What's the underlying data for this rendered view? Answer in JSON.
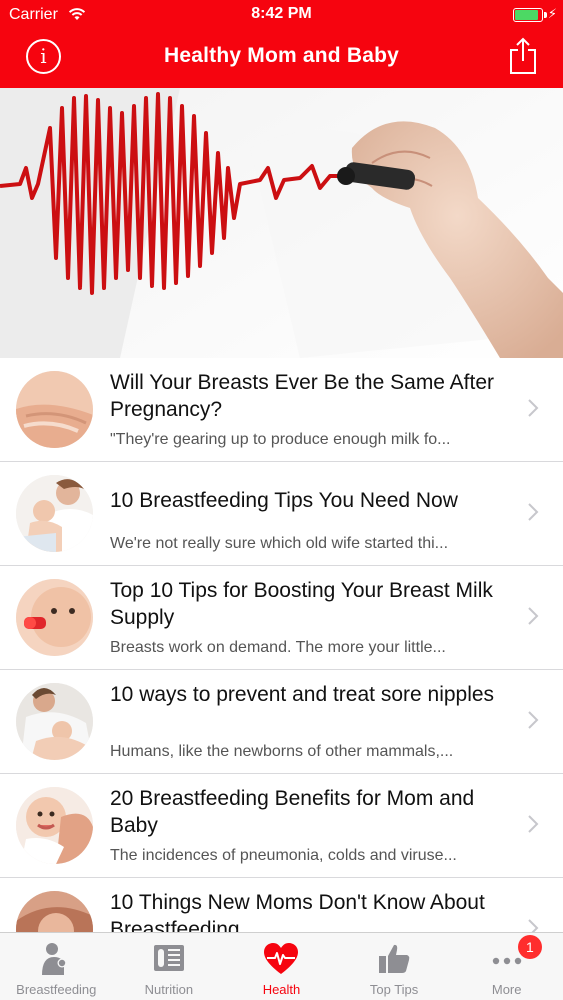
{
  "status_bar": {
    "carrier": "Carrier",
    "time": "8:42 PM",
    "battery_level": 0.9
  },
  "nav": {
    "title": "Healthy Mom and Baby",
    "info_glyph": "i",
    "left_icon": "info-icon",
    "right_icon": "share-icon"
  },
  "colors": {
    "brand_red": "#f6040f",
    "tab_inactive": "#8e8e93",
    "badge_red": "#ff2d2d"
  },
  "articles": [
    {
      "title": "Will Your Breasts Ever Be the Same After Pregnancy?",
      "excerpt": "\"They're gearing up to produce enough milk fo..."
    },
    {
      "title": "10 Breastfeeding Tips You Need Now",
      "excerpt": "We're not really sure which old wife started thi..."
    },
    {
      "title": "Top 10 Tips for Boosting Your Breast Milk Supply",
      "excerpt": "Breasts work on demand. The more your little..."
    },
    {
      "title": "10 ways to prevent and treat sore nipples",
      "excerpt": "Humans, like the newborns of other mammals,..."
    },
    {
      "title": "20 Breastfeeding Benefits for Mom and Baby",
      "excerpt": "The incidences of pneumonia, colds and viruse..."
    },
    {
      "title": "10 Things New Moms Don't Know About Breastfeeding",
      "excerpt": ""
    }
  ],
  "tabs": [
    {
      "label": "Breastfeeding",
      "icon": "mother-baby-icon",
      "active": false
    },
    {
      "label": "Nutrition",
      "icon": "nutrition-icon",
      "active": false
    },
    {
      "label": "Health",
      "icon": "heart-pulse-icon",
      "active": true
    },
    {
      "label": "Top Tips",
      "icon": "thumbs-up-icon",
      "active": false
    },
    {
      "label": "More",
      "icon": "more-icon",
      "active": false,
      "badge": "1"
    }
  ]
}
